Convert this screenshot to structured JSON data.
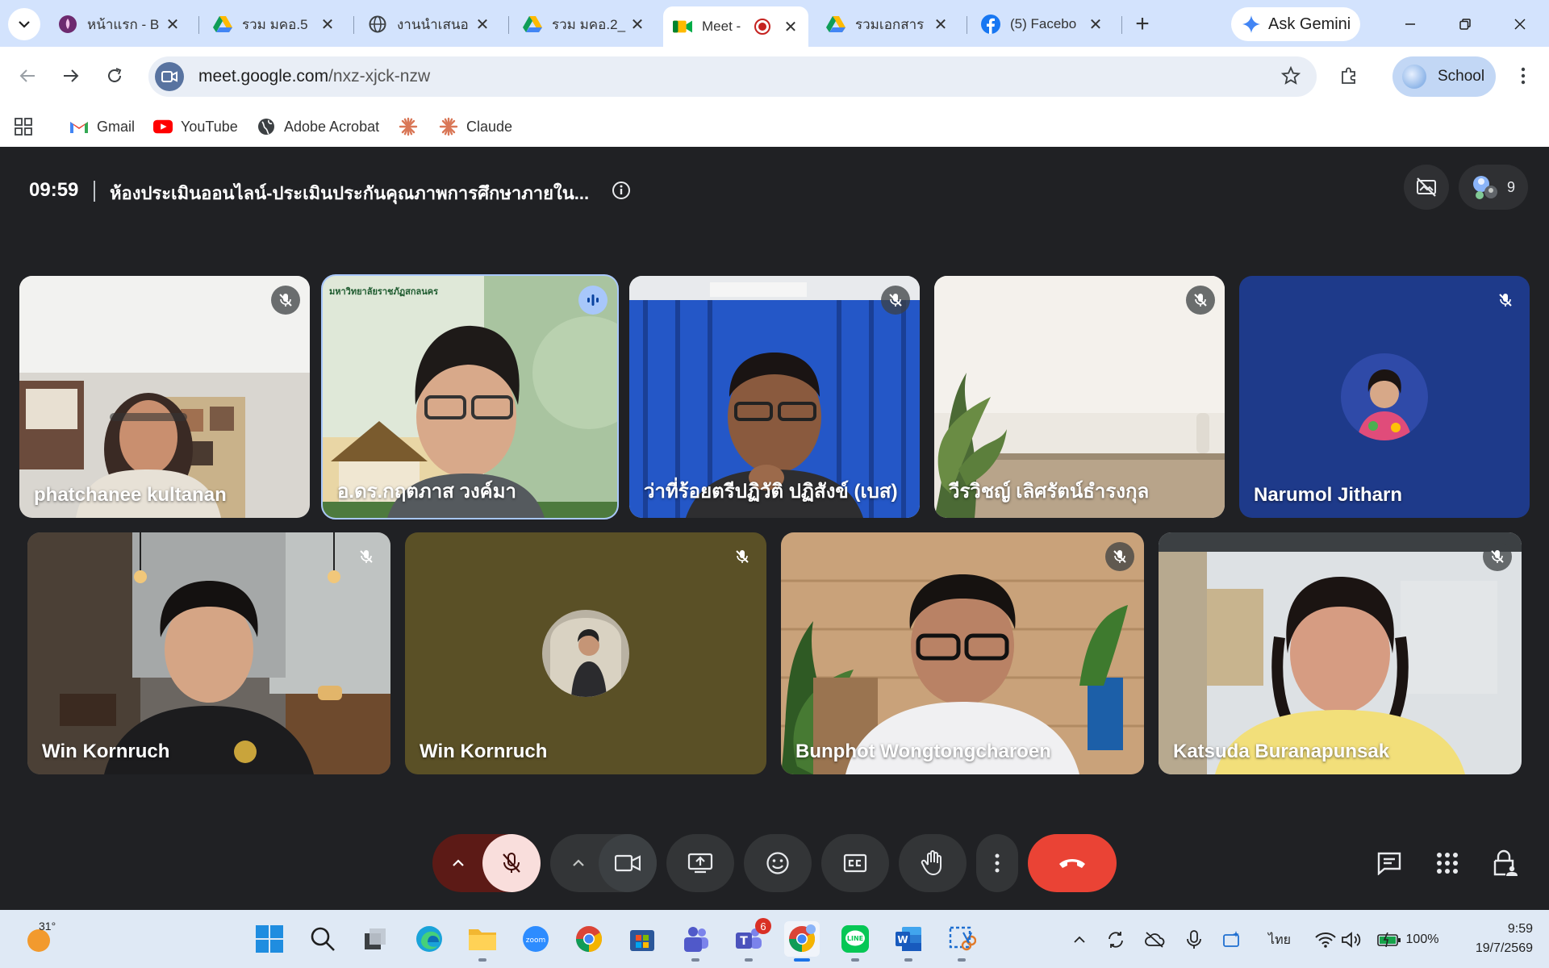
{
  "browser": {
    "tabs": [
      {
        "title": "หน้าแรก - B",
        "icon": "lotus-icon",
        "active": false
      },
      {
        "title": "รวม มคอ.5",
        "icon": "google-drive-icon",
        "active": false
      },
      {
        "title": "งานนำเสนอ",
        "icon": "globe-icon",
        "active": false
      },
      {
        "title": "รวม มคอ.2_",
        "icon": "google-drive-icon",
        "active": false
      },
      {
        "title": "Meet -",
        "icon": "google-meet-icon",
        "active": true
      },
      {
        "title": "รวมเอกสาร",
        "icon": "google-drive-icon",
        "active": false
      },
      {
        "title": "(5) Facebo",
        "icon": "facebook-icon",
        "active": false
      }
    ],
    "ask_gemini_label": "Ask Gemini",
    "url_domain": "meet.google.com",
    "url_path": "/nxz-xjck-nzw",
    "profile_label": "School",
    "bookmarks": [
      {
        "label": "Gmail",
        "icon": "gmail-icon"
      },
      {
        "label": "YouTube",
        "icon": "youtube-icon"
      },
      {
        "label": "Adobe Acrobat",
        "icon": "globe-icon"
      },
      {
        "label": "",
        "icon": "claude-icon"
      },
      {
        "label": "Claude",
        "icon": "claude-icon"
      }
    ]
  },
  "meet": {
    "time": "09:59",
    "title": "ห้องประเมินออนไลน์-ประเมินประกันคุณภาพการศึกษาภายใน...",
    "participant_count": "9",
    "participants": [
      {
        "name": "phatchanee kultanan",
        "muted": true,
        "speaking": false
      },
      {
        "name": "อ.ดร.กฤตภาส วงค์มา",
        "muted": false,
        "speaking": true
      },
      {
        "name": "ว่าที่ร้อยตรีปฏิวัติ ปฏิสังข์ (เบส)",
        "muted": true,
        "speaking": false
      },
      {
        "name": "วีรวิชญ์ เลิศรัตน์ธำรงกุล",
        "muted": true,
        "speaking": false
      },
      {
        "name": "Narumol Jitharn",
        "muted": true,
        "speaking": false
      },
      {
        "name": "Win Kornruch",
        "muted": true,
        "speaking": false
      },
      {
        "name": "Win Kornruch",
        "muted": true,
        "speaking": false
      },
      {
        "name": "Bunphot Wongtongcharoen",
        "muted": true,
        "speaking": false
      },
      {
        "name": "Katsuda Buranapunsak",
        "muted": true,
        "speaking": false
      }
    ],
    "tile_banner_text": "มหาวิทยาลัยราชภัฏสกลนคร"
  },
  "taskbar": {
    "weather_temp": "31°",
    "teams_badge": "6",
    "language": "ไทย",
    "battery": "100%",
    "clock_time": "9:59",
    "clock_date": "19/7/2569"
  },
  "colors": {
    "meet_bg": "#202124",
    "end_call": "#ea4335",
    "mic_off_bg": "#f9dedc",
    "speaking_ring": "#a8c7fa",
    "chrome_frame": "#d3e3fd"
  }
}
